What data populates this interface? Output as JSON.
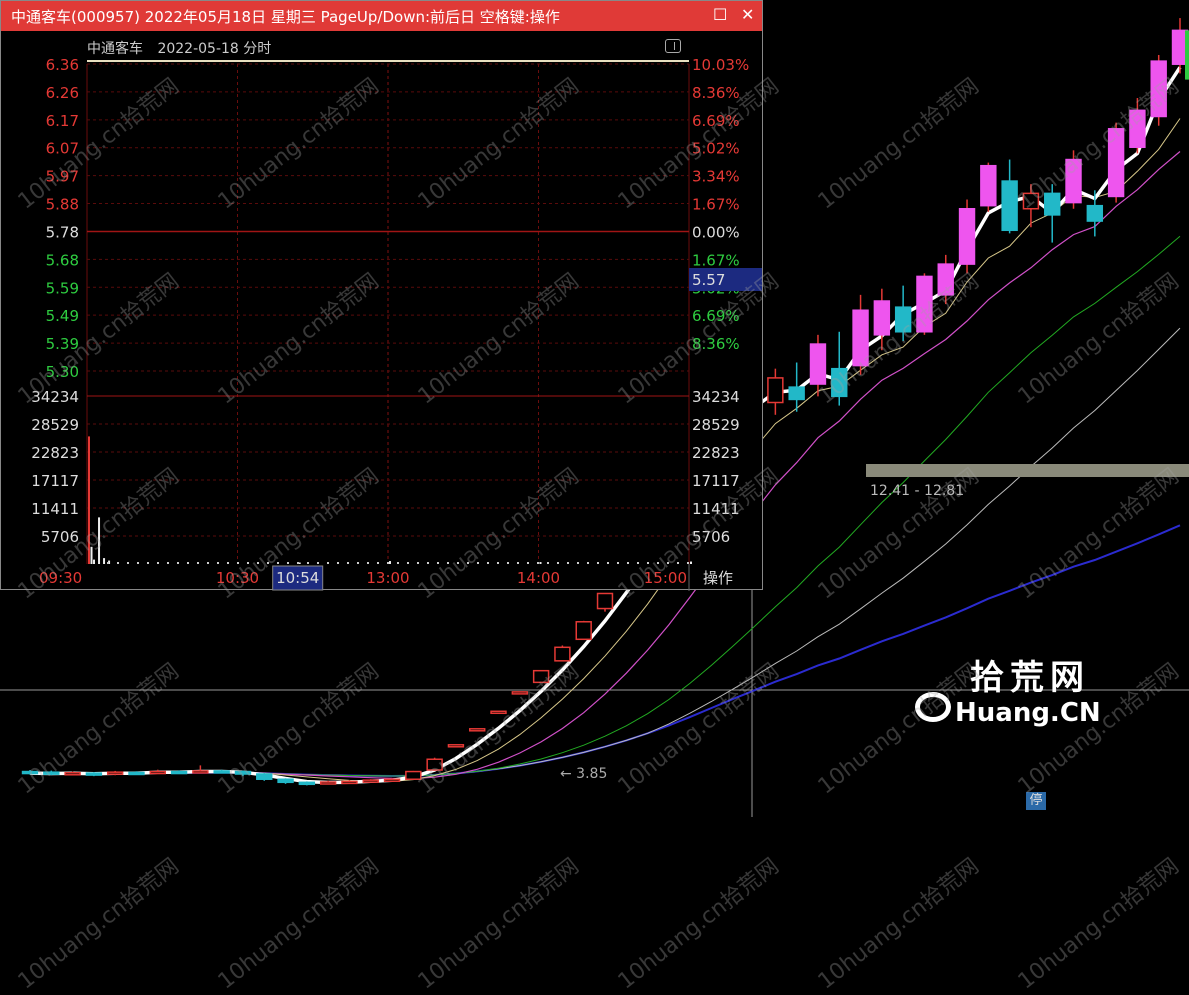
{
  "window": {
    "title": "中通客车(000957) 2022年05月18日 星期三 PageUp/Down:前后日 空格键:操作",
    "minimize_glyph": "☐",
    "close_glyph": "✕"
  },
  "minute_chart": {
    "header_name": "中通客车",
    "header_date": "2022-05-18 分时",
    "operate_label": "操作",
    "current_time_label": "10:54",
    "current_price_label": "5.57",
    "prev_close": 5.78
  },
  "kline_overlay": {
    "range_label": "12.41 - 12.81",
    "min_label": "← 3.85",
    "stop_badge": "停",
    "watermark_cn": "拾荒网",
    "watermark_en": "Huang.CN",
    "watermark_repeat": "10huang.cn拾荒网"
  },
  "colors": {
    "up": "#e53935",
    "down": "#2ecc40",
    "neutral": "#ffffff",
    "titlebar": "#e03a37",
    "bull_body": "#ee55ee",
    "bear_body": "#ee55ee",
    "grid": "#7a1010"
  },
  "chart_data": [
    {
      "type": "line",
      "title": "中通客车 2022-05-18 分时",
      "prev_close": 5.78,
      "price_ticks_left": [
        "6.36",
        "6.26",
        "6.17",
        "6.07",
        "5.97",
        "5.88",
        "5.78",
        "5.68",
        "5.59",
        "5.49",
        "5.39",
        "5.30"
      ],
      "pct_ticks_right": [
        "10.03%",
        "8.36%",
        "6.69%",
        "5.02%",
        "3.34%",
        "1.67%",
        "0.00%",
        "1.67%",
        "5.02%",
        "6.69%",
        "8.36%"
      ],
      "volume_ticks": [
        "34234",
        "28529",
        "22823",
        "17117",
        "11411",
        "5706"
      ],
      "time_ticks": [
        "09:30",
        "10:30",
        "13:00",
        "14:00",
        "15:00"
      ],
      "ylim_price": [
        5.25,
        6.36
      ],
      "ylim_volume": [
        0,
        34234
      ],
      "volume_bars": [
        {
          "time": "09:30",
          "value": 26000
        },
        {
          "time": "09:31",
          "value": 3500
        },
        {
          "time": "09:32",
          "value": 900
        },
        {
          "time": "09:34",
          "value": 9500
        },
        {
          "time": "09:36",
          "value": 1200
        },
        {
          "time": "09:38",
          "value": 700
        },
        {
          "time": "10:54",
          "value": 300
        },
        {
          "time": "13:00",
          "value": 600
        },
        {
          "time": "14:00",
          "value": 400
        },
        {
          "time": "15:00",
          "value": 500
        }
      ]
    },
    {
      "type": "candlestick",
      "title": "",
      "min_price_annotation": 3.85,
      "high_range": [
        12.41,
        12.81
      ],
      "candles": [
        {
          "o": 4.3,
          "c": 4.25,
          "h": 4.35,
          "l": 4.2
        },
        {
          "o": 4.28,
          "c": 4.22,
          "h": 4.33,
          "l": 4.18
        },
        {
          "o": 4.24,
          "c": 4.26,
          "h": 4.3,
          "l": 4.2
        },
        {
          "o": 4.25,
          "c": 4.2,
          "h": 4.28,
          "l": 4.15
        },
        {
          "o": 4.22,
          "c": 4.28,
          "h": 4.32,
          "l": 4.18
        },
        {
          "o": 4.27,
          "c": 4.25,
          "h": 4.31,
          "l": 4.21
        },
        {
          "o": 4.25,
          "c": 4.3,
          "h": 4.36,
          "l": 4.22
        },
        {
          "o": 4.3,
          "c": 4.28,
          "h": 4.34,
          "l": 4.24
        },
        {
          "o": 4.28,
          "c": 4.32,
          "h": 4.5,
          "l": 4.26
        },
        {
          "o": 4.32,
          "c": 4.3,
          "h": 4.36,
          "l": 4.26
        },
        {
          "o": 4.3,
          "c": 4.22,
          "h": 4.33,
          "l": 4.15
        },
        {
          "o": 4.22,
          "c": 4.05,
          "h": 4.25,
          "l": 4.0
        },
        {
          "o": 4.05,
          "c": 3.95,
          "h": 4.08,
          "l": 3.9
        },
        {
          "o": 3.95,
          "c": 3.92,
          "h": 3.98,
          "l": 3.85
        },
        {
          "o": 3.92,
          "c": 3.96,
          "h": 4.0,
          "l": 3.88
        },
        {
          "o": 3.96,
          "c": 3.98,
          "h": 4.02,
          "l": 3.93
        },
        {
          "o": 3.98,
          "c": 4.02,
          "h": 4.05,
          "l": 3.95
        },
        {
          "o": 4.02,
          "c": 4.05,
          "h": 4.08,
          "l": 3.99
        },
        {
          "o": 4.05,
          "c": 4.3,
          "h": 4.32,
          "l": 4.03
        },
        {
          "o": 4.35,
          "c": 4.7,
          "h": 4.75,
          "l": 4.34
        },
        {
          "o": 5.17,
          "c": 5.17,
          "h": 5.17,
          "l": 5.17
        },
        {
          "o": 5.69,
          "c": 5.69,
          "h": 5.69,
          "l": 5.69
        },
        {
          "o": 6.26,
          "c": 6.26,
          "h": 6.26,
          "l": 6.26
        },
        {
          "o": 6.89,
          "c": 6.89,
          "h": 6.89,
          "l": 6.89
        },
        {
          "o": 7.2,
          "c": 7.58,
          "h": 7.6,
          "l": 7.18
        },
        {
          "o": 7.9,
          "c": 8.34,
          "h": 8.4,
          "l": 7.88
        },
        {
          "o": 8.6,
          "c": 9.17,
          "h": 9.2,
          "l": 8.58
        },
        {
          "o": 9.6,
          "c": 10.09,
          "h": 10.1,
          "l": 9.5
        },
        {
          "o": 11.09,
          "c": 11.09,
          "h": 11.09,
          "l": 10.8
        },
        {
          "o": 11.5,
          "c": 12.2,
          "h": 12.2,
          "l": 11.4
        },
        {
          "o": 12.4,
          "c": 13.42,
          "h": 13.42,
          "l": 12.38
        },
        {
          "o": 13.5,
          "c": 14.76,
          "h": 14.76,
          "l": 13.3
        },
        {
          "o": 14.5,
          "c": 15.6,
          "h": 16.0,
          "l": 14.2
        },
        {
          "o": 15.2,
          "c": 16.2,
          "h": 16.8,
          "l": 14.9
        },
        {
          "o": 15.8,
          "c": 16.6,
          "h": 17.2,
          "l": 15.5
        },
        {
          "o": 16.3,
          "c": 17.1,
          "h": 17.4,
          "l": 15.9
        },
        {
          "o": 16.8,
          "c": 16.4,
          "h": 17.6,
          "l": 16.0
        },
        {
          "o": 16.9,
          "c": 18.2,
          "h": 18.5,
          "l": 16.5
        },
        {
          "o": 17.4,
          "c": 16.5,
          "h": 18.6,
          "l": 16.2
        },
        {
          "o": 17.5,
          "c": 19.3,
          "h": 19.8,
          "l": 17.2
        },
        {
          "o": 18.5,
          "c": 19.6,
          "h": 20.0,
          "l": 18.0
        },
        {
          "o": 19.4,
          "c": 18.6,
          "h": 20.1,
          "l": 18.3
        },
        {
          "o": 18.6,
          "c": 20.4,
          "h": 20.5,
          "l": 18.5
        },
        {
          "o": 19.8,
          "c": 20.8,
          "h": 21.1,
          "l": 19.5
        },
        {
          "o": 20.8,
          "c": 22.6,
          "h": 22.9,
          "l": 20.5
        },
        {
          "o": 22.7,
          "c": 24.0,
          "h": 24.1,
          "l": 22.5
        },
        {
          "o": 23.5,
          "c": 21.9,
          "h": 24.2,
          "l": 21.8
        },
        {
          "o": 22.6,
          "c": 23.1,
          "h": 23.4,
          "l": 22.0
        },
        {
          "o": 23.1,
          "c": 22.4,
          "h": 23.4,
          "l": 21.5
        },
        {
          "o": 22.8,
          "c": 24.2,
          "h": 24.5,
          "l": 22.6
        },
        {
          "o": 22.7,
          "c": 22.2,
          "h": 23.2,
          "l": 21.7
        },
        {
          "o": 23.0,
          "c": 25.2,
          "h": 25.4,
          "l": 22.8
        },
        {
          "o": 24.6,
          "c": 25.8,
          "h": 26.2,
          "l": 24.4
        },
        {
          "o": 25.6,
          "c": 27.4,
          "h": 27.6,
          "l": 25.3
        },
        {
          "o": 27.3,
          "c": 28.4,
          "h": 28.8,
          "l": 27.0
        }
      ]
    }
  ]
}
